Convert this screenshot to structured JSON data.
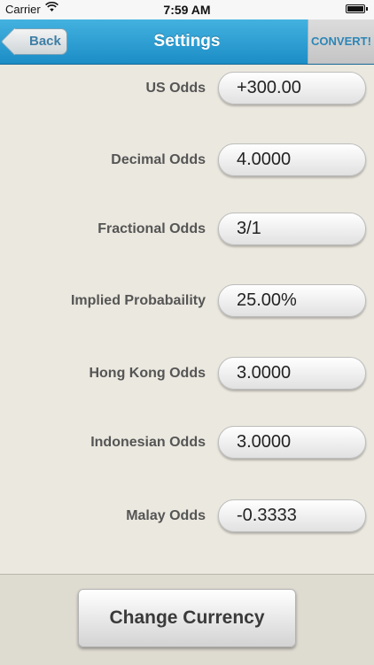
{
  "status": {
    "carrier": "Carrier",
    "time": "7:59 AM"
  },
  "nav": {
    "back_label": "Back",
    "title": "Settings",
    "convert_label": "CONVERT!"
  },
  "fields": [
    {
      "label": "US Odds",
      "value": "+300.00"
    },
    {
      "label": "Decimal Odds",
      "value": "4.0000"
    },
    {
      "label": "Fractional Odds",
      "value": "3/1"
    },
    {
      "label": "Implied Probabaility",
      "value": "25.00%"
    },
    {
      "label": "Hong Kong Odds",
      "value": "3.0000"
    },
    {
      "label": "Indonesian Odds",
      "value": "3.0000"
    },
    {
      "label": "Malay Odds",
      "value": "-0.3333"
    }
  ],
  "bottom": {
    "change_currency_label": "Change Currency"
  },
  "colors": {
    "nav_accent": "#1c8dc6",
    "background": "#ebe8df"
  }
}
